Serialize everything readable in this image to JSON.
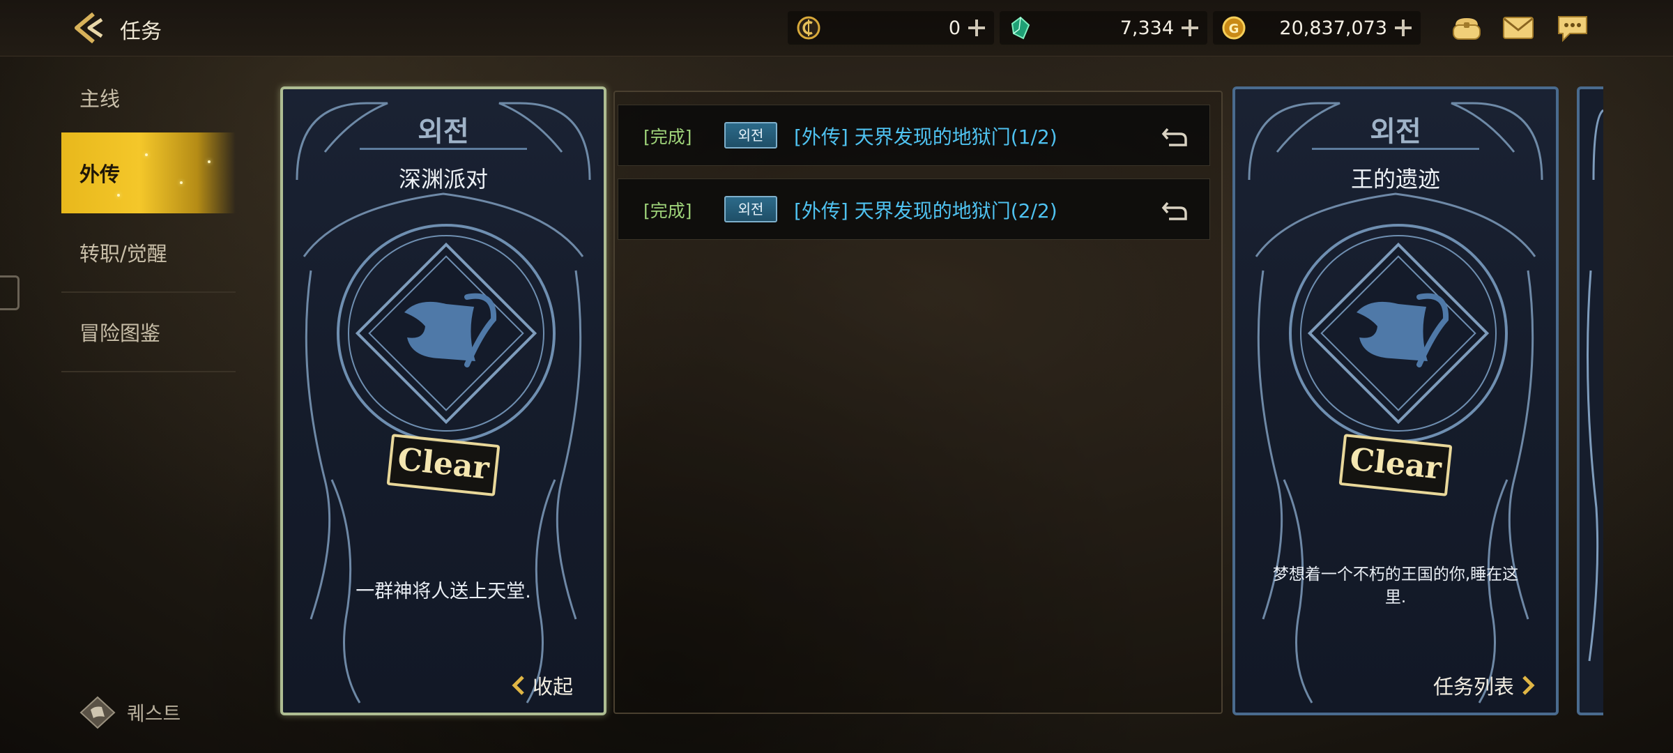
{
  "header": {
    "title": "任务",
    "currencies": [
      {
        "name": "c-coin-icon",
        "value": "0",
        "color": "#d8a93a"
      },
      {
        "name": "green-gem-icon",
        "value": "7,334",
        "color": "#2fbf8a"
      },
      {
        "name": "gold-coin-icon",
        "value": "20,837,073",
        "color": "#e0a624"
      }
    ]
  },
  "sidebar": {
    "items": [
      {
        "label": "主线",
        "active": false
      },
      {
        "label": "外传",
        "active": true
      },
      {
        "label": "转职/觉醒",
        "active": false
      },
      {
        "label": "冒险图鉴",
        "active": false
      }
    ]
  },
  "brand": {
    "label": "퀘스트"
  },
  "cards": [
    {
      "header": "외전",
      "title": "深渊派对",
      "stamp": "Clear",
      "description": "一群神将人送上天堂.",
      "footer": "收起"
    },
    {
      "header": "외전",
      "title": "王的遗迹",
      "stamp": "Clear",
      "description": "梦想着一个不朽的王国的你,睡在这里.",
      "footer": "任务列表"
    }
  ],
  "quests": [
    {
      "status": "[完成]",
      "badge": "외전",
      "title": "[外传] 天界发现的地狱门(1/2)"
    },
    {
      "status": "[完成]",
      "badge": "외전",
      "title": "[外传] 天界发现的地狱门(2/2)"
    }
  ]
}
